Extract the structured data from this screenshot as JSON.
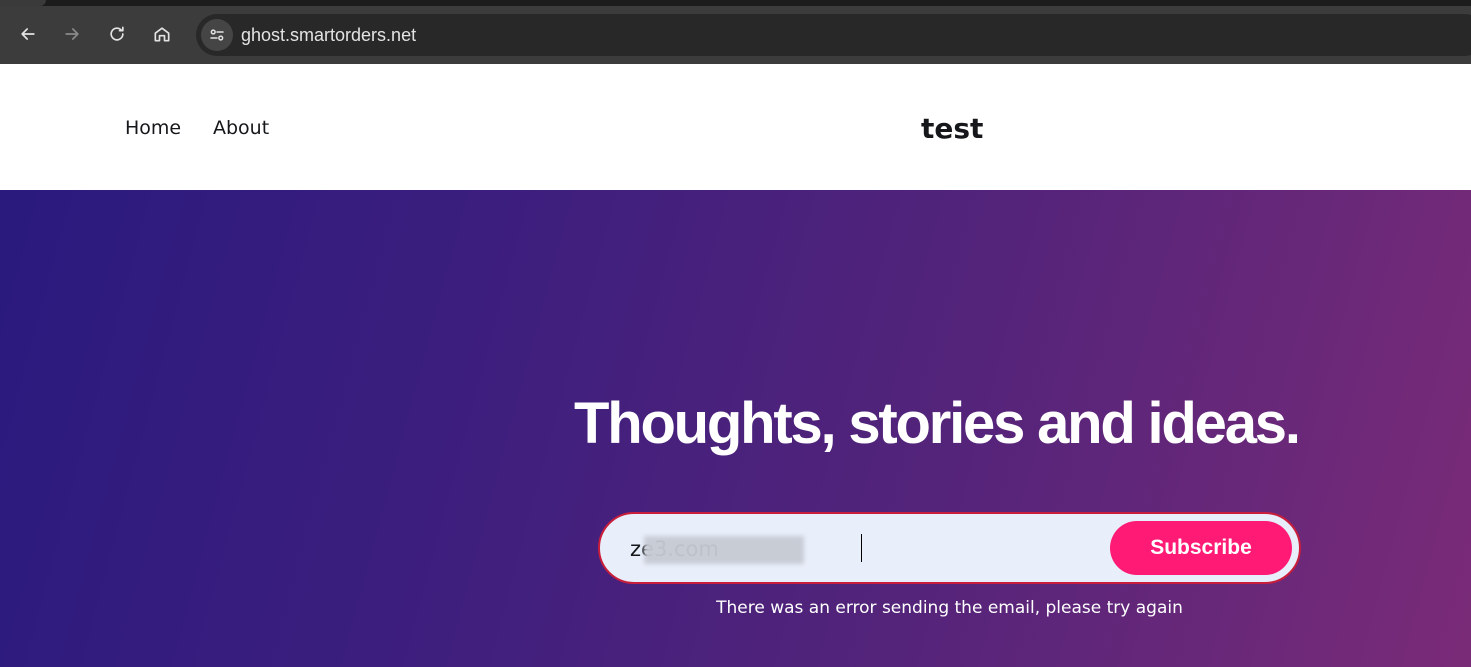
{
  "browser": {
    "url": "ghost.smartorders.net",
    "icons": [
      "back-arrow-icon",
      "forward-arrow-icon",
      "reload-icon",
      "home-icon",
      "site-settings-icon"
    ]
  },
  "header": {
    "nav": [
      {
        "label": "Home"
      },
      {
        "label": "About"
      }
    ],
    "site_title": "test"
  },
  "hero": {
    "headline": "Thoughts, stories and ideas.",
    "email_value": "ze3.com",
    "subscribe_label": "Subscribe",
    "error_message": "There was an error sending the email, please try again"
  },
  "colors": {
    "subscribe_button": "#ff1a75",
    "hero_gradient_start": "#2a1a7e",
    "hero_gradient_end": "#7a2b78",
    "input_border_error": "#c81e3c",
    "input_background": "#e8eefa"
  }
}
